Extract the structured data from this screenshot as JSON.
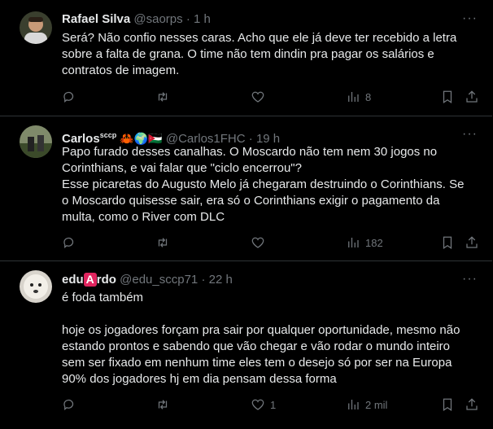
{
  "tweets": [
    {
      "name": "Rafael Silva",
      "handle": "@saorps",
      "dot": "·",
      "time": "1 h",
      "more": "···",
      "text": "Será? Não confio nesses caras. Acho que ele já deve ter recebido a letra\nsobre a falta de grana. O time não tem dindin pra pagar os salários e\ncontratos de imagem.",
      "stats": {
        "replies": "",
        "retweets": "",
        "likes": "",
        "views": "8"
      }
    },
    {
      "name": "Carlos",
      "name_sup": "sccp",
      "emojis": "🦀🌍🇯🇴",
      "handle": "@Carlos1FHC",
      "dot": "·",
      "time": "19 h",
      "more": "···",
      "text": "Papo furado desses canalhas. O Moscardo não tem nem 30 jogos no\nCorinthians, e vai falar que \"ciclo encerrou\"?\nEsse picaretas do Augusto Melo já chegaram destruindo o Corinthians. Se\no Moscardo quisesse sair, era só o Corinthians exigir o pagamento da\nmulta, como o River com DLC",
      "stats": {
        "replies": "",
        "retweets": "",
        "likes": "",
        "views": "182"
      }
    },
    {
      "name_before": "edu",
      "name_badge": "A",
      "name_after": "rdo",
      "handle": "@edu_sccp71",
      "dot": "·",
      "time": "22 h",
      "more": "···",
      "text": "é foda também\n\nhoje os jogadores forçam pra sair por qualquer oportunidade, mesmo não\nestando prontos e sabendo que vão chegar e vão rodar o mundo inteiro\nsem ser fixado em nenhum time eles tem o desejo só por ser na Europa\n90% dos jogadores hj em dia pensam dessa forma",
      "stats": {
        "replies": "",
        "retweets": "",
        "likes": "1",
        "views": "2 mil"
      }
    }
  ]
}
